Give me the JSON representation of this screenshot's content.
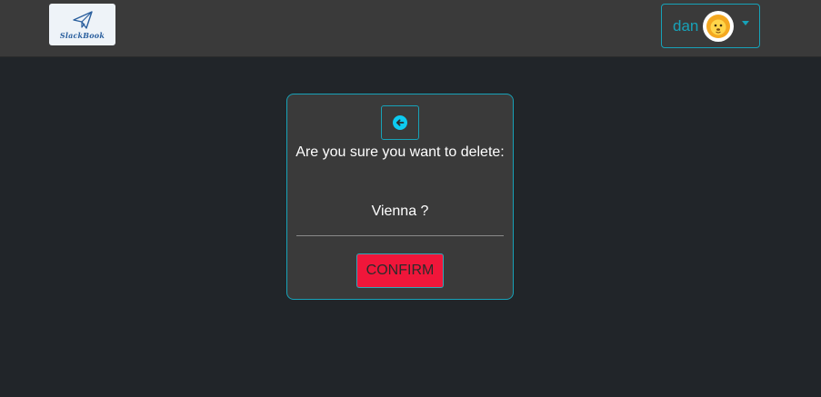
{
  "navbar": {
    "logo_text": "SlackBook",
    "user": {
      "username": "dan",
      "avatar_icon": "lion-avatar-icon"
    }
  },
  "dialog": {
    "back_icon": "arrow-left-circle-icon",
    "question": "Are you sure you want to delete:",
    "item_name": "Vienna ?",
    "confirm_label": "CONFIRM"
  },
  "colors": {
    "background": "#212529",
    "navbar": "#3a3a3a",
    "card": "#3a3a3a",
    "accent": "#17a2b8",
    "back_icon": "#0dcaf0",
    "danger": "#f0163a"
  }
}
